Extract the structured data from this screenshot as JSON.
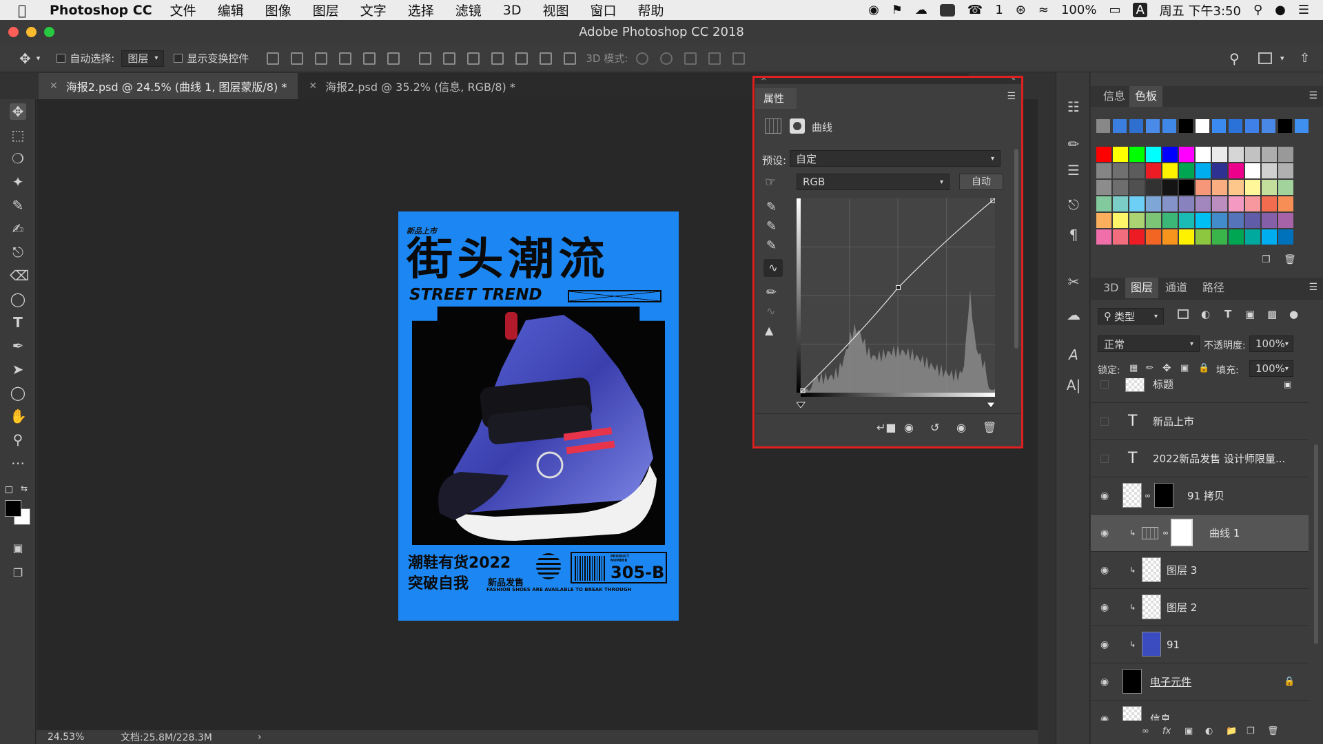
{
  "menubar": {
    "app_name": "Photoshop CC",
    "items": [
      "文件",
      "编辑",
      "图像",
      "图层",
      "文字",
      "选择",
      "滤镜",
      "3D",
      "视图",
      "窗口",
      "帮助"
    ],
    "status": {
      "notifications": "1",
      "battery": "100%",
      "datetime": "周五 下午3:50",
      "input": "A"
    }
  },
  "window": {
    "title": "Adobe Photoshop CC 2018"
  },
  "options_bar": {
    "auto_select_label": "自动选择:",
    "auto_select_value": "图层",
    "show_transform_label": "显示变换控件",
    "mode_3d_label": "3D 模式:"
  },
  "tabs": [
    {
      "label": "海报2.psd @ 24.5% (曲线 1, 图层蒙版/8) *",
      "active": true
    },
    {
      "label": "海报2.psd @ 35.2% (信息, RGB/8) *",
      "active": false
    }
  ],
  "poster": {
    "tag": "新品上市",
    "title_cn": "街头潮流",
    "title_en": "STREET TREND",
    "line1": "潮鞋有货2022",
    "line2": "突破自我",
    "release": "新品发售",
    "model": "305-B",
    "product_number": "PRODUCT NUMBER",
    "tagline": "FASHION SHOES ARE AVAILABLE TO BREAK THROUGH",
    "bg_color": "#1c87f2"
  },
  "properties": {
    "tab": "属性",
    "type_label": "曲线",
    "preset_label": "预设:",
    "preset_value": "自定",
    "channel_value": "RGB",
    "auto_button": "自动",
    "curve_point": {
      "input": 128,
      "output": 138
    }
  },
  "status_bar": {
    "zoom": "24.53%",
    "doc_size": "文档:25.8M/228.3M"
  },
  "swatches_panel": {
    "tabs": [
      "信息",
      "色板"
    ],
    "active": "色板",
    "recent": [
      "#888888",
      "#3a7fe0",
      "#2f6fd0",
      "#4a8ae8",
      "#3f88e8",
      "#000000",
      "#ffffff",
      "#3a8af0",
      "#2b72d8",
      "#3f7fe8",
      "#4a88e8",
      "#000000",
      "#3f8ff0"
    ],
    "grid": [
      [
        "#ff0000",
        "#ffff00",
        "#00ff00",
        "#00ffff",
        "#0000ff",
        "#ff00ff",
        "#ffffff",
        "#ebebeb",
        "#d6d6d6",
        "#c2c2c2",
        "#adadad",
        "#999999"
      ],
      [
        "#858585",
        "#707070",
        "#5c5c5c",
        "#ed1c24",
        "#fff200",
        "#00a651",
        "#00aeef",
        "#2e3192",
        "#ec008c",
        "#ffffff",
        "#d0d0d0",
        "#b0b0b0"
      ],
      [
        "#8c8c8c",
        "#6e6e6e",
        "#505050",
        "#323232",
        "#141414",
        "#000000",
        "#f7977a",
        "#f9ad81",
        "#fdc68a",
        "#fff79a",
        "#c4df9b",
        "#a2d39c"
      ],
      [
        "#82ca9d",
        "#7bcdc8",
        "#6ecff6",
        "#7ea7d8",
        "#8493ca",
        "#8882be",
        "#a187be",
        "#bc8dbf",
        "#f49ac2",
        "#f6989d",
        "#f26c4f",
        "#f68e56"
      ],
      [
        "#fbaf5d",
        "#fff568",
        "#acd372",
        "#7cc576",
        "#3bb878",
        "#1abbb4",
        "#00bff3",
        "#438ccb",
        "#5574b9",
        "#605ca8",
        "#855fa8",
        "#a763a8"
      ],
      [
        "#f06ea9",
        "#f26d7d",
        "#ed1c24",
        "#f26522",
        "#f7941d",
        "#fff200",
        "#8dc63f",
        "#39b54a",
        "#00a651",
        "#00a99d",
        "#00aeef",
        "#0072bc"
      ]
    ]
  },
  "layers_panel": {
    "tabs": [
      "3D",
      "图层",
      "通道",
      "路径"
    ],
    "active": "图层",
    "filter_label": "类型",
    "blend_mode": "正常",
    "opacity_label": "不透明度:",
    "opacity": "100%",
    "lock_label": "锁定:",
    "fill_label": "填充:",
    "fill": "100%",
    "layers": [
      {
        "name": "标题",
        "kind": "group",
        "visible": false
      },
      {
        "name": "新品上市",
        "kind": "text",
        "visible": false
      },
      {
        "name": "2022新品发售 设计师限量...",
        "kind": "text",
        "visible": false
      },
      {
        "name": "91 拷贝",
        "kind": "image-mask",
        "visible": true
      },
      {
        "name": "曲线 1",
        "kind": "adjustment",
        "visible": true,
        "selected": true
      },
      {
        "name": "图层 3",
        "kind": "pixel",
        "visible": true
      },
      {
        "name": "图层 2",
        "kind": "pixel",
        "visible": true
      },
      {
        "name": "91",
        "kind": "image",
        "visible": true
      },
      {
        "name": "电子元件",
        "kind": "locked",
        "visible": true
      },
      {
        "name": "信息",
        "kind": "pixel",
        "visible": true
      }
    ]
  }
}
